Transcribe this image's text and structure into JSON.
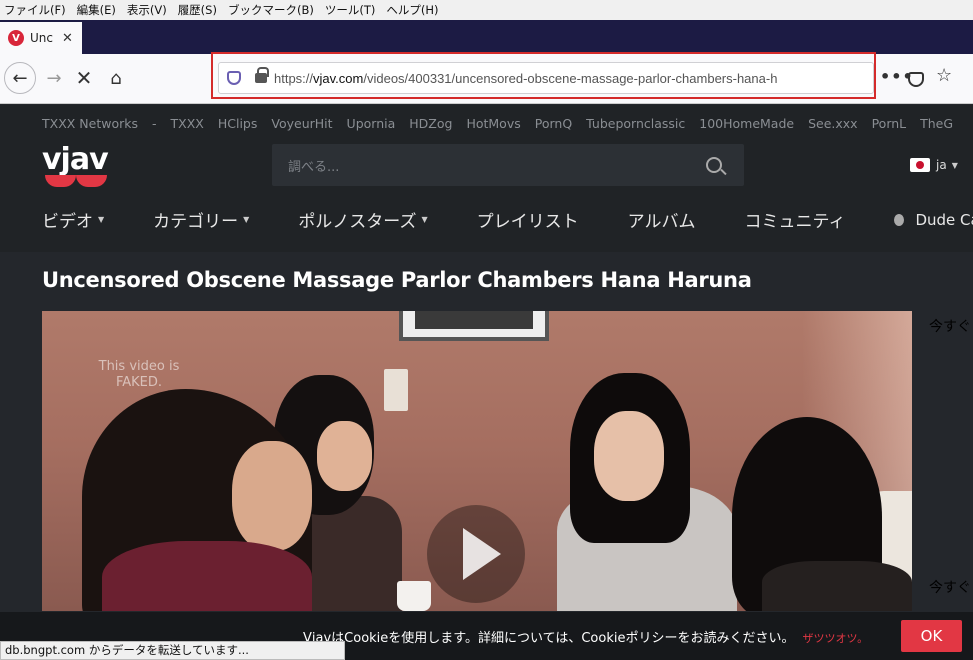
{
  "menubar": {
    "items": [
      "ファイル(F)",
      "編集(E)",
      "表示(V)",
      "履歴(S)",
      "ブックマーク(B)",
      "ツール(T)",
      "ヘルプ(H)"
    ]
  },
  "tab": {
    "favicon_letter": "V",
    "title": "Unc"
  },
  "urlbar": {
    "url_prefix": "https://",
    "url_domain": "vjav.com",
    "url_path": "/videos/400331/uncensored-obscene-massage-parlor-chambers-hana-h"
  },
  "site": {
    "network": [
      "TXXX Networks",
      "-",
      "TXXX",
      "HClips",
      "VoyeurHit",
      "Upornia",
      "HDZog",
      "HotMovs",
      "PornQ",
      "Tubepornclassic",
      "100HomeMade",
      "See.xxx",
      "PornL",
      "TheG"
    ],
    "logo_text": "vjav",
    "search_placeholder": "調べる...",
    "language": "ja",
    "nav": [
      "ビデオ",
      "カテゴリー",
      "ポルノスターズ",
      "プレイリスト",
      "アルバム",
      "コミュニティ",
      "Dude Cams"
    ]
  },
  "video": {
    "title": "Uncensored Obscene Massage Parlor Chambers Hana Haruna",
    "watermark_line1": "This video is",
    "watermark_line2": "FAKED."
  },
  "sidebar": {
    "text_top": "今すぐ",
    "text_bottom": "今すぐ"
  },
  "cookie": {
    "message": "VjavはCookieを使用します。詳細については、Cookieポリシーをお読みください。",
    "link": "ザツツオツ。",
    "ok_label": "OK"
  },
  "status": {
    "text": "db.bngpt.com からデータを転送しています..."
  },
  "colors": {
    "accent": "#e23744",
    "header_bg": "#202326",
    "page_bg": "#24272c",
    "tabstrip": "#1c1b44"
  }
}
